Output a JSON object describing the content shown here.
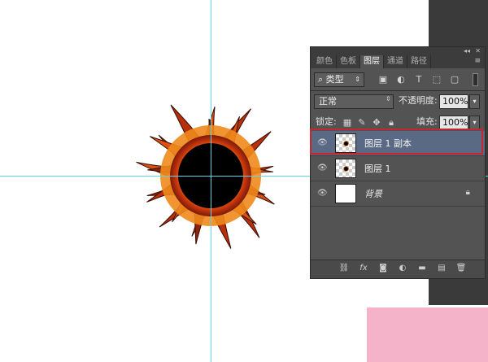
{
  "panel": {
    "tabs": [
      "颜色",
      "色板",
      "图层",
      "通道",
      "路径"
    ],
    "active_tab": "图层",
    "filter": {
      "label": "类型"
    },
    "blend_mode": "正常",
    "opacity": {
      "label": "不透明度:",
      "value": "100%"
    },
    "lock": {
      "label": "锁定:"
    },
    "fill": {
      "label": "填充:",
      "value": "100%"
    }
  },
  "layers": [
    {
      "name": "图层 1 副本",
      "selected": true
    },
    {
      "name": "图层 1",
      "selected": false
    },
    {
      "name": "背景",
      "selected": false,
      "locked": true
    }
  ],
  "icons": {
    "filter_icons": [
      "image-filter-icon",
      "adjustment-filter-icon",
      "type-filter-icon",
      "shape-filter-icon",
      "smart-object-filter-icon"
    ],
    "lock_icons": [
      "lock-transparent-icon",
      "lock-image-icon",
      "lock-position-icon",
      "lock-all-icon"
    ],
    "bottom_icons": [
      "link-layers-icon",
      "fx-icon",
      "add-mask-icon",
      "adjustment-layer-icon",
      "new-group-icon",
      "new-layer-icon",
      "delete-layer-icon"
    ]
  },
  "colors": {
    "guide": "#5fd8e6",
    "selection_outline": "#c8262d",
    "panel_bg": "#535353",
    "selected_layer": "#5a6a85"
  }
}
